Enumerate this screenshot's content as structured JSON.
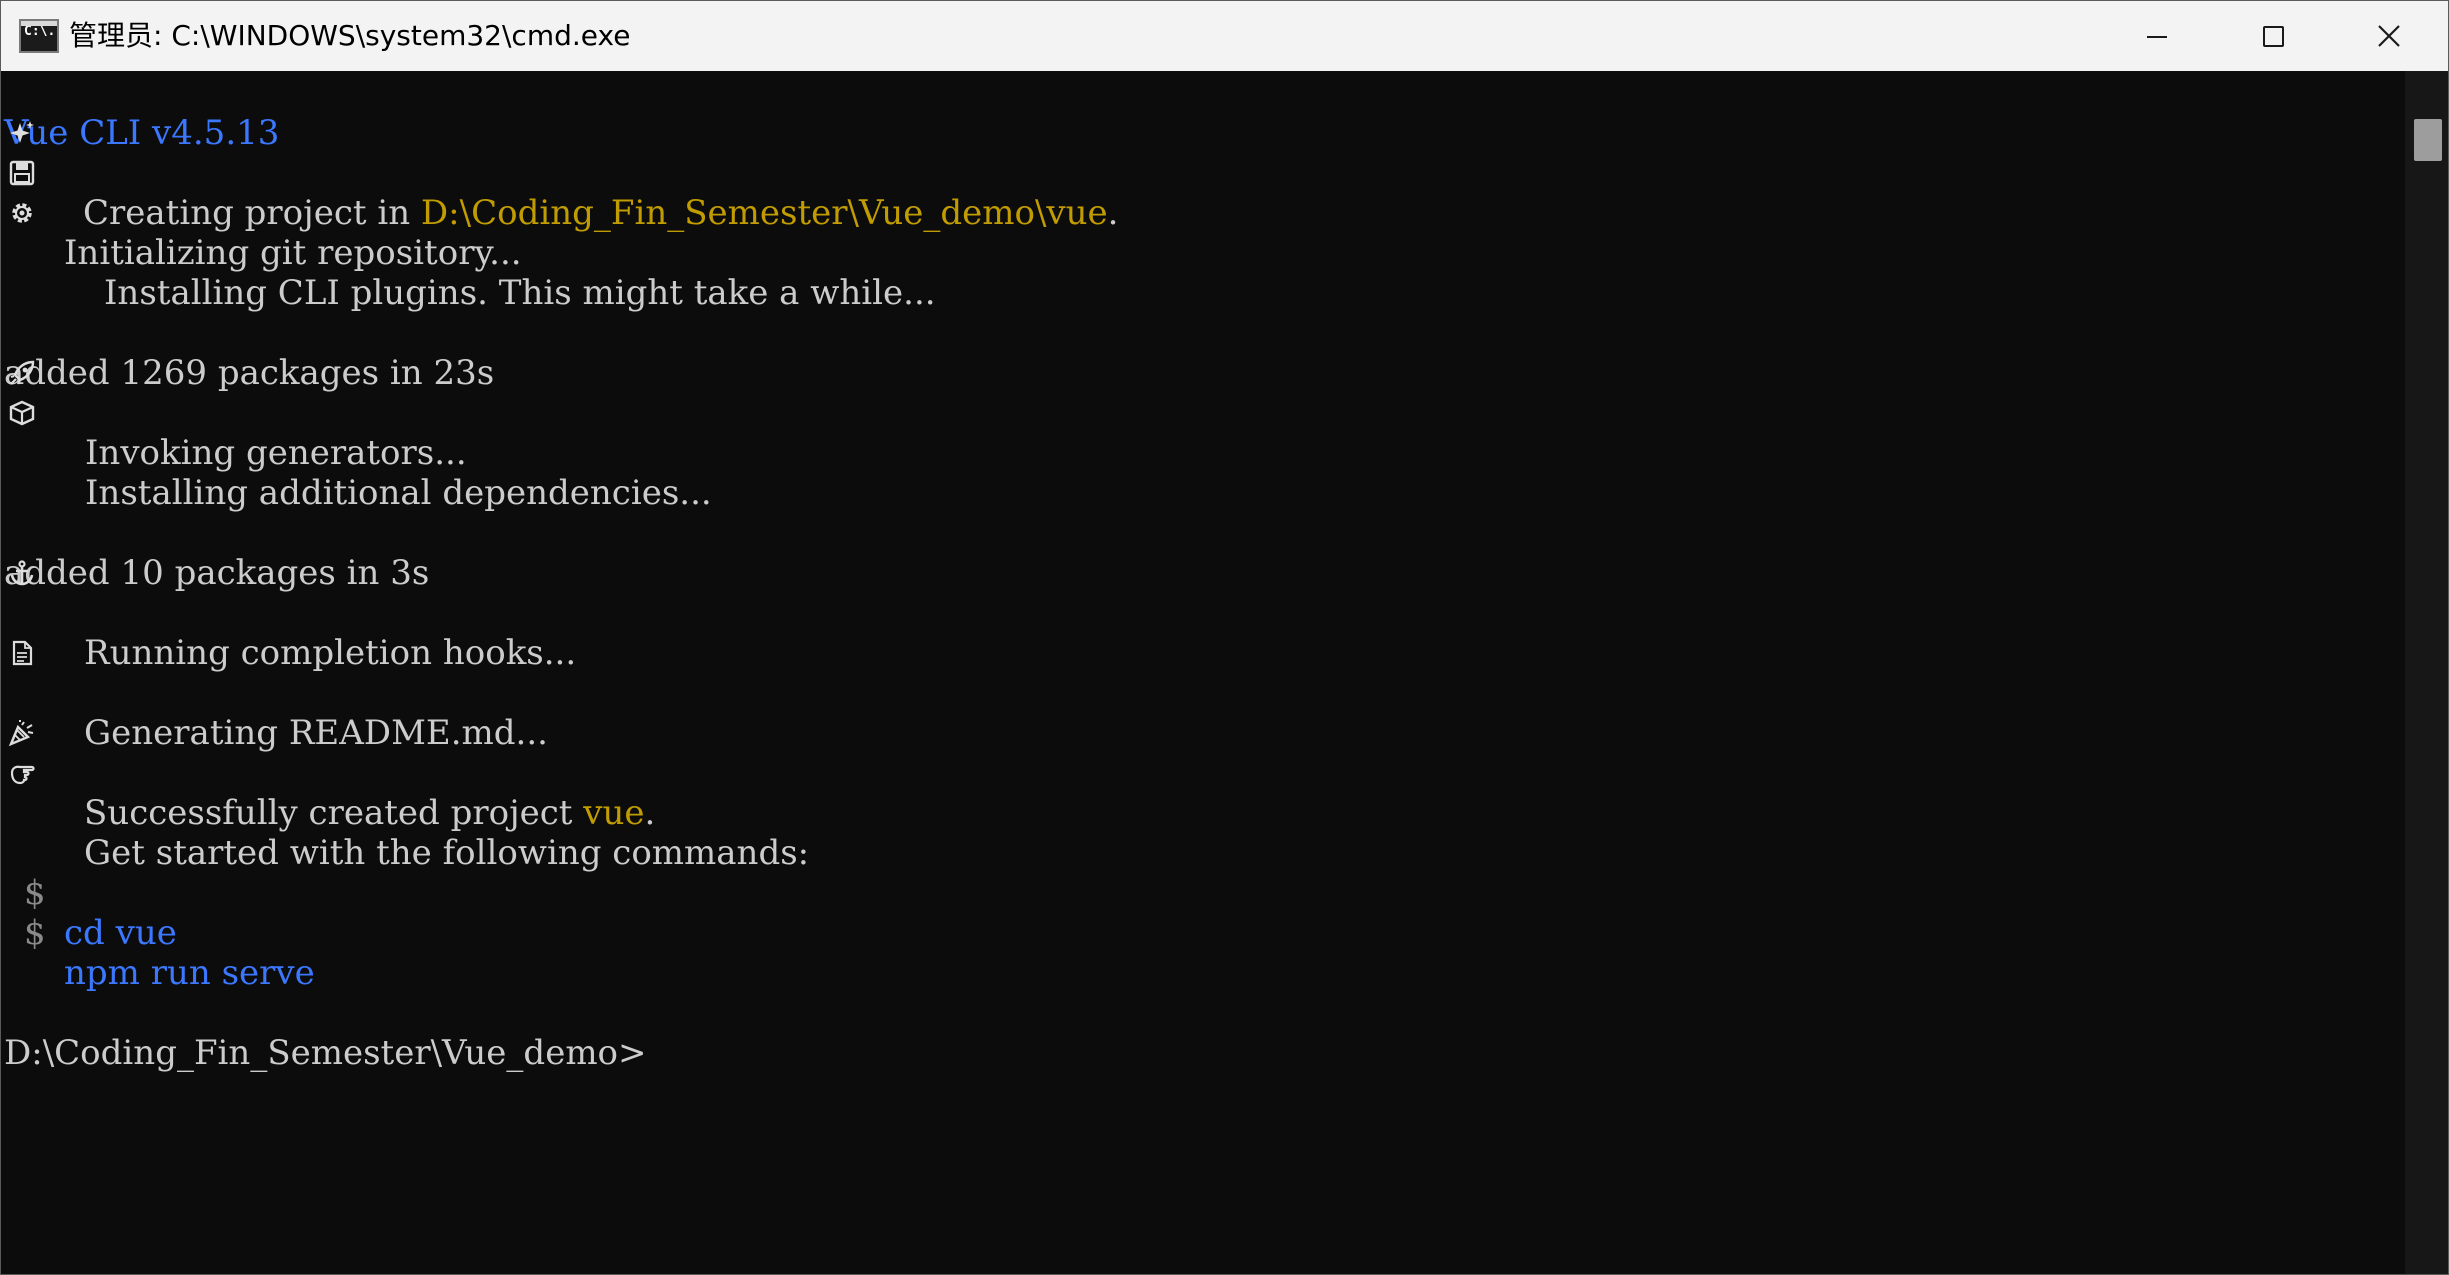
{
  "window": {
    "title": "管理员:  C:\\WINDOWS\\system32\\cmd.exe",
    "app_icon_label": "C:\\."
  },
  "console": {
    "header": "Vue CLI v4.5.13",
    "creating_prefix": "Creating project in ",
    "creating_path": "D:\\Coding_Fin_Semester\\Vue_demo\\vue",
    "creating_suffix": ".",
    "init_git": "Initializing git repository...",
    "installing_plugins": "Installing CLI plugins. This might take a while...",
    "added_1": "added 1269 packages in 23s",
    "invoking": "Invoking generators...",
    "installing_deps": "Installing additional dependencies...",
    "added_2": "added 10 packages in 3s",
    "running_hooks": "Running completion hooks...",
    "generating_readme": "Generating README.md...",
    "success_prefix": "Successfully created project ",
    "success_name": "vue",
    "success_suffix": ".",
    "get_started": "Get started with the following commands:",
    "prompt_symbol": "$",
    "cmd_1": "cd vue",
    "cmd_2": "npm run serve",
    "final_prompt": "D:\\Coding_Fin_Semester\\Vue_demo>"
  },
  "icons": {
    "sparkles": "sparkles-icon",
    "git": "floppy-disk-icon",
    "plugins": "gear-icon",
    "generators": "rocket-icon",
    "deps": "package-icon",
    "hooks": "anchor-icon",
    "readme": "document-icon",
    "success": "party-popper-icon",
    "commands": "pointing-hand-icon"
  },
  "colors": {
    "background": "#0c0c0c",
    "text": "#cccccc",
    "blue": "#3b78ff",
    "yellow": "#c19c00"
  }
}
